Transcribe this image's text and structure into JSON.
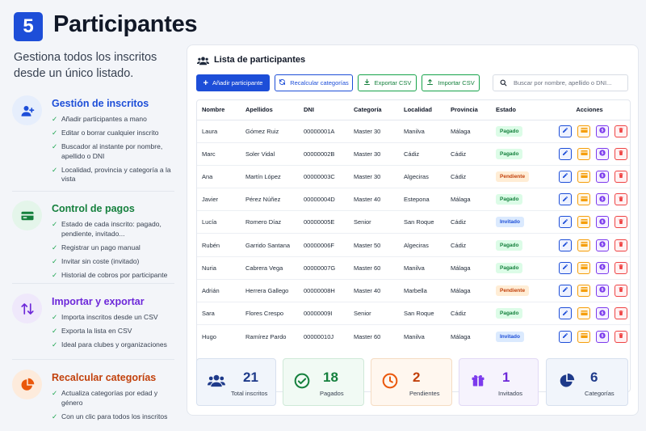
{
  "header": {
    "step": "5",
    "title": "Participantes",
    "subtitle": "Gestiona todos los inscritos desde un único listado."
  },
  "features": [
    {
      "title": "Gestión de inscritos",
      "color": "#1d4ed8",
      "icon": "user-plus-icon",
      "items": [
        "Añadir participantes a mano",
        "Editar o borrar cualquier inscrito",
        "Buscador al instante por nombre, apellido o DNI",
        "Localidad, provincia y categoría a la vista"
      ]
    },
    {
      "title": "Control de pagos",
      "color": "#15803d",
      "icon": "card-icon",
      "items": [
        "Estado de cada inscrito: pagado, pendiente, invitado...",
        "Registrar un pago manual",
        "Invitar sin coste (invitado)",
        "Historial de cobros por participante"
      ]
    },
    {
      "title": "Importar y exportar",
      "color": "#6d28d9",
      "icon": "swap-arrows-icon",
      "items": [
        "Importa inscritos desde un CSV",
        "Exporta la lista en CSV",
        "Ideal para clubes y organizaciones"
      ]
    },
    {
      "title": "Recalcular categorías",
      "color": "#c2410c",
      "icon": "pie-chart-icon",
      "items": [
        "Actualiza categorías por edad y género",
        "Con un clic para todos los inscritos"
      ]
    }
  ],
  "card": {
    "title": "Lista de participantes",
    "buttons": {
      "add": "Añadir participante",
      "recalc": "Recalcular categorías",
      "export": "Exportar CSV",
      "import": "Importar CSV"
    },
    "search_placeholder": "Buscar por nombre, apellido o DNI..."
  },
  "table": {
    "columns": [
      "Nombre",
      "Apellidos",
      "DNI",
      "Categoría",
      "Localidad",
      "Provincia",
      "Estado",
      "Acciones"
    ],
    "rows": [
      {
        "nombre": "Laura",
        "apellidos": "Gómez Ruiz",
        "dni": "00000001A",
        "categoria": "Master 30",
        "localidad": "Manilva",
        "provincia": "Málaga",
        "estado": "Pagado"
      },
      {
        "nombre": "Marc",
        "apellidos": "Soler Vidal",
        "dni": "00000002B",
        "categoria": "Master 30",
        "localidad": "Cádiz",
        "provincia": "Cádiz",
        "estado": "Pagado"
      },
      {
        "nombre": "Ana",
        "apellidos": "Martín López",
        "dni": "00000003C",
        "categoria": "Master 30",
        "localidad": "Algeciras",
        "provincia": "Cádiz",
        "estado": "Pendiente"
      },
      {
        "nombre": "Javier",
        "apellidos": "Pérez Núñez",
        "dni": "00000004D",
        "categoria": "Master 40",
        "localidad": "Estepona",
        "provincia": "Málaga",
        "estado": "Pagado"
      },
      {
        "nombre": "Lucía",
        "apellidos": "Romero Díaz",
        "dni": "00000005E",
        "categoria": "Senior",
        "localidad": "San Roque",
        "provincia": "Cádiz",
        "estado": "Invitado"
      },
      {
        "nombre": "Rubén",
        "apellidos": "Garrido Santana",
        "dni": "00000006F",
        "categoria": "Master 50",
        "localidad": "Algeciras",
        "provincia": "Cádiz",
        "estado": "Pagado"
      },
      {
        "nombre": "Nuria",
        "apellidos": "Cabrera Vega",
        "dni": "00000007G",
        "categoria": "Master 60",
        "localidad": "Manilva",
        "provincia": "Málaga",
        "estado": "Pagado"
      },
      {
        "nombre": "Adrián",
        "apellidos": "Herrera Gallego",
        "dni": "00000008H",
        "categoria": "Master 40",
        "localidad": "Marbella",
        "provincia": "Málaga",
        "estado": "Pendiente"
      },
      {
        "nombre": "Sara",
        "apellidos": "Flores Crespo",
        "dni": "00000009I",
        "categoria": "Senior",
        "localidad": "San Roque",
        "provincia": "Cádiz",
        "estado": "Pagado"
      },
      {
        "nombre": "Hugo",
        "apellidos": "Ramírez Pardo",
        "dni": "00000010J",
        "categoria": "Master 60",
        "localidad": "Manilva",
        "provincia": "Málaga",
        "estado": "Invitado"
      }
    ]
  },
  "stats": [
    {
      "value": "21",
      "label": "Total inscritos",
      "color": "#1e3a8a",
      "bg": "#f1f5fb",
      "border": "#d7e0ee",
      "icon": "users-icon"
    },
    {
      "value": "18",
      "label": "Pagados",
      "color": "#15803d",
      "bg": "#f1faf4",
      "border": "#cfe9d8",
      "icon": "check-circle-icon"
    },
    {
      "value": "2",
      "label": "Pendientes",
      "color": "#c2410c",
      "bg": "#fff7ef",
      "border": "#f5dcc2",
      "icon": "clock-icon"
    },
    {
      "value": "1",
      "label": "Invitados",
      "color": "#6d28d9",
      "bg": "#f6f3fd",
      "border": "#e2d9f5",
      "icon": "gift-icon"
    },
    {
      "value": "6",
      "label": "Categorías",
      "color": "#1e3a8a",
      "bg": "#f1f5fb",
      "border": "#d7e0ee",
      "icon": "pie-chart-icon"
    }
  ]
}
